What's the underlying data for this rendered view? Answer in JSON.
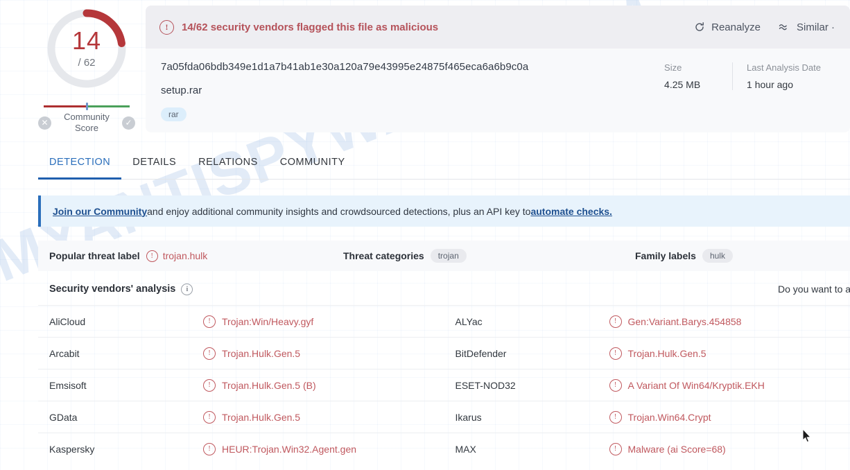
{
  "watermark": {
    "text": "MYANTISPYWARE.COM"
  },
  "score": {
    "detections": "14",
    "total": "/ 62",
    "ratio_value": 14,
    "ratio_total": 62,
    "arc_color": "#b5373a",
    "track_color": "#e6e8ec"
  },
  "community_score": {
    "label_line1": "Community",
    "label_line2": "Score",
    "negative_icon": "close-circle-icon",
    "positive_icon": "check-circle-icon",
    "negative_glyph": "✕",
    "positive_glyph": "✓",
    "bar_negative_color": "#ad2f30",
    "bar_positive_color": "#4aa05a",
    "marker_color": "#6f95c9"
  },
  "alert": {
    "icon": "exclamation-circle-icon",
    "glyph": "!",
    "text": "14/62 security vendors flagged this file as malicious",
    "color": "#b5525a",
    "actions": [
      {
        "name": "reanalyze-button",
        "label": "Reanalyze",
        "icon": "refresh-icon"
      },
      {
        "name": "similar-button",
        "label": "Similar ·",
        "icon": "similar-icon"
      }
    ]
  },
  "file": {
    "hash": "7a05fda06bdb349e1d1a7b41ab1e30a120a79e43995e24875f465eca6a6b9c0a",
    "name": "setup.rar",
    "tags": [
      "rar"
    ],
    "meta": [
      {
        "key": "Size",
        "value": "4.25 MB"
      },
      {
        "key": "Last Analysis Date",
        "value": "1 hour ago"
      }
    ]
  },
  "tabs": [
    {
      "label": "DETECTION",
      "active": true
    },
    {
      "label": "DETAILS",
      "active": false
    },
    {
      "label": "RELATIONS",
      "active": false
    },
    {
      "label": "COMMUNITY",
      "active": false
    }
  ],
  "banner": {
    "link_start": "Join our Community",
    "middle": " and enjoy additional community insights and crowdsourced detections, plus an API key to ",
    "link_end": "automate checks.",
    "accent_color": "#2a6ebb"
  },
  "threat": {
    "popular_label_key": "Popular threat label",
    "popular_label_value": "trojan.hulk",
    "categories_key": "Threat categories",
    "categories_value": "trojan",
    "family_key": "Family labels",
    "family_value": "hulk"
  },
  "vendors_section": {
    "title": "Security vendors' analysis",
    "info_icon": "info-circle-icon",
    "right_text": "Do you want to au"
  },
  "vendors": [
    {
      "left_name": "AliCloud",
      "left_result": "Trojan:Win/Heavy.gyf",
      "right_name": "ALYac",
      "right_result": "Gen:Variant.Barys.454858"
    },
    {
      "left_name": "Arcabit",
      "left_result": "Trojan.Hulk.Gen.5",
      "right_name": "BitDefender",
      "right_result": "Trojan.Hulk.Gen.5"
    },
    {
      "left_name": "Emsisoft",
      "left_result": "Trojan.Hulk.Gen.5 (B)",
      "right_name": "ESET-NOD32",
      "right_result": "A Variant Of Win64/Kryptik.EKH"
    },
    {
      "left_name": "GData",
      "left_result": "Trojan.Hulk.Gen.5",
      "right_name": "Ikarus",
      "right_result": "Trojan.Win64.Crypt"
    },
    {
      "left_name": "Kaspersky",
      "left_result": "HEUR:Trojan.Win32.Agent.gen",
      "right_name": "MAX",
      "right_result": "Malware (ai Score=68)"
    }
  ],
  "colors": {
    "malicious_red": "#c0585e",
    "link_blue": "#2a6ebb",
    "tag_blue_bg": "#dceefb"
  }
}
